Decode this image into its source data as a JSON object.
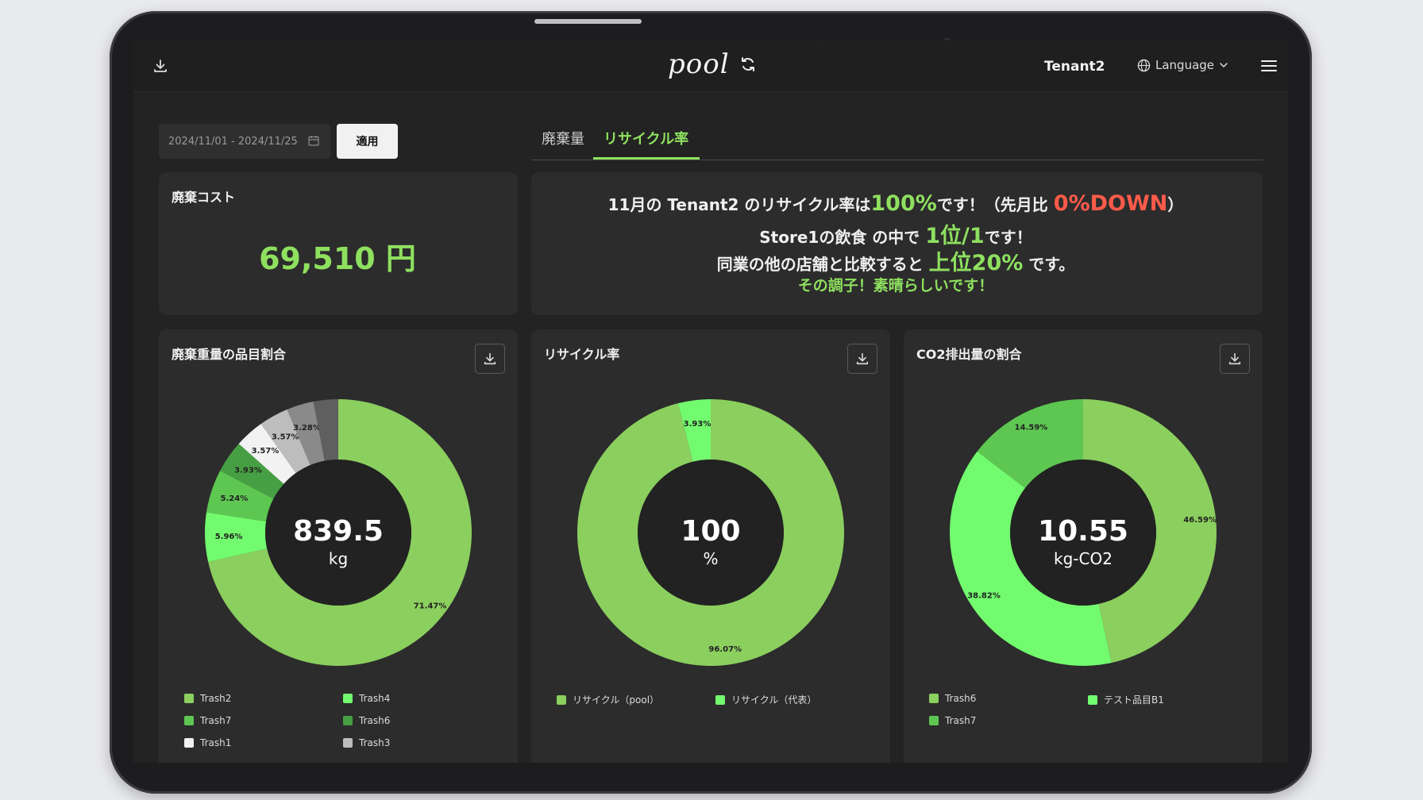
{
  "header": {
    "logo": "pool",
    "tenant": "Tenant2",
    "language_label": "Language"
  },
  "filter": {
    "date_range": "2024/11/01 - 2024/11/25",
    "apply_label": "適用"
  },
  "tabs": [
    {
      "label": "廃棄量",
      "active": false
    },
    {
      "label": "リサイクル率",
      "active": true
    }
  ],
  "cost_card": {
    "title": "廃棄コスト",
    "value": "69,510 円"
  },
  "message": {
    "line1_a": "11月の Tenant2 のリサイクル率は",
    "line1_rate": "100%",
    "line1_b": "です！（先月比 ",
    "line1_change": "0%DOWN",
    "line1_c": "）",
    "line2_a": "Store1の飲食 の中で ",
    "line2_rank": "1位/1",
    "line2_b": "です！",
    "line3_a": "同業の他の店舗と比較すると ",
    "line3_top": "上位20%",
    "line3_b": " です。",
    "line4": "その調子！素晴らしいです！"
  },
  "colors": {
    "accent": "#8ee05f",
    "down_red": "#ff5b4a",
    "light_green": "#8bcf5e",
    "bright_green": "#72fb6e",
    "mid_green": "#5ec752",
    "dark_green": "#46a043"
  },
  "chart_data": [
    {
      "type": "pie",
      "title": "廃棄重量の品目割合",
      "center_value": "839.5",
      "center_unit": "kg",
      "slices": [
        {
          "name": "Trash2",
          "value": 71.47,
          "label": "71.47%",
          "color": "#8bcf5e"
        },
        {
          "name": "Trash4",
          "value": 5.96,
          "label": "5.96%",
          "color": "#72fb6e"
        },
        {
          "name": "Trash7",
          "value": 5.24,
          "label": "5.24%",
          "color": "#5ec752"
        },
        {
          "name": "Trash6",
          "value": 3.93,
          "label": "3.93%",
          "color": "#46a043"
        },
        {
          "name": "Trash1",
          "value": 3.57,
          "label": "3.57%",
          "color": "#f2f2f2"
        },
        {
          "name": "Trash3",
          "value": 3.57,
          "label": "3.57%",
          "color": "#bdbdbd"
        },
        {
          "name": "",
          "value": 3.28,
          "label": "3.28%",
          "color": "#8a8a8a"
        },
        {
          "name": "",
          "value": 2.98,
          "label": "",
          "color": "#5f5f5f"
        }
      ],
      "legend": [
        "Trash2",
        "Trash4",
        "Trash7",
        "Trash6",
        "Trash1",
        "Trash3"
      ]
    },
    {
      "type": "pie",
      "title": "リサイクル率",
      "center_value": "100",
      "center_unit": "%",
      "slices": [
        {
          "name": "リサイクル（pool）",
          "value": 96.07,
          "label": "96.07%",
          "color": "#8bcf5e"
        },
        {
          "name": "リサイクル（代表）",
          "value": 3.93,
          "label": "3.93%",
          "color": "#72fb6e"
        }
      ],
      "legend": [
        "リサイクル（pool）",
        "リサイクル（代表）"
      ]
    },
    {
      "type": "pie",
      "title": "CO2排出量の割合",
      "center_value": "10.55",
      "center_unit": "kg-CO2",
      "slices": [
        {
          "name": "Trash6",
          "value": 46.59,
          "label": "46.59%",
          "color": "#8bcf5e"
        },
        {
          "name": "テスト品目B1",
          "value": 38.82,
          "label": "38.82%",
          "color": "#72fb6e"
        },
        {
          "name": "Trash7",
          "value": 14.59,
          "label": "14.59%",
          "color": "#5ec752"
        }
      ],
      "legend": [
        "Trash6",
        "テスト品目B1",
        "Trash7"
      ]
    }
  ]
}
